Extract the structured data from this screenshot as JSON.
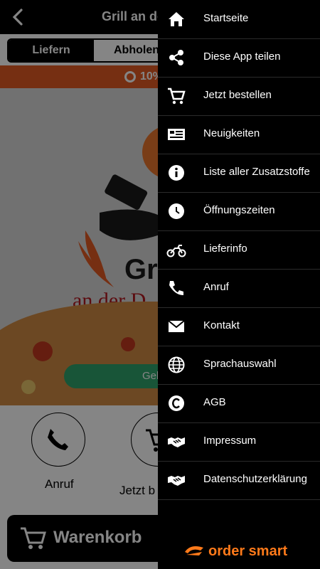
{
  "header": {
    "title": "Grill an de"
  },
  "toggle": {
    "deliver": "Liefern",
    "pickup": "Abholen"
  },
  "promo": {
    "text": "10%"
  },
  "hero": {
    "brand_partial": "Gri",
    "brand_sub": "an der D",
    "cta": "Gel"
  },
  "actions": [
    {
      "label": "Anruf",
      "icon": "phone-icon"
    },
    {
      "label": "Jetzt b",
      "icon": "cart-icon"
    }
  ],
  "cart": {
    "label": "Warenkorb"
  },
  "menu": [
    {
      "label": "Startseite",
      "icon": "home-icon"
    },
    {
      "label": "Diese App teilen",
      "icon": "share-icon"
    },
    {
      "label": "Jetzt bestellen",
      "icon": "cart-icon"
    },
    {
      "label": "Neuigkeiten",
      "icon": "news-icon"
    },
    {
      "label": "Liste aller Zusatzstoffe",
      "icon": "info-icon"
    },
    {
      "label": "Öffnungszeiten",
      "icon": "clock-icon"
    },
    {
      "label": "Lieferinfo",
      "icon": "motorbike-icon"
    },
    {
      "label": "Anruf",
      "icon": "phone-icon"
    },
    {
      "label": "Kontakt",
      "icon": "mail-icon"
    },
    {
      "label": "Sprachauswahl",
      "icon": "globe-icon"
    },
    {
      "label": "AGB",
      "icon": "copyright-icon"
    },
    {
      "label": "Impressum",
      "icon": "handshake-icon"
    },
    {
      "label": "Datenschutzerklärung",
      "icon": "handshake-icon"
    }
  ],
  "brand": {
    "name": "order smart"
  },
  "colors": {
    "accent": "#ff7a1a",
    "promo": "#e35a24",
    "cta": "#2ea36b",
    "menu_bg": "#000000"
  }
}
